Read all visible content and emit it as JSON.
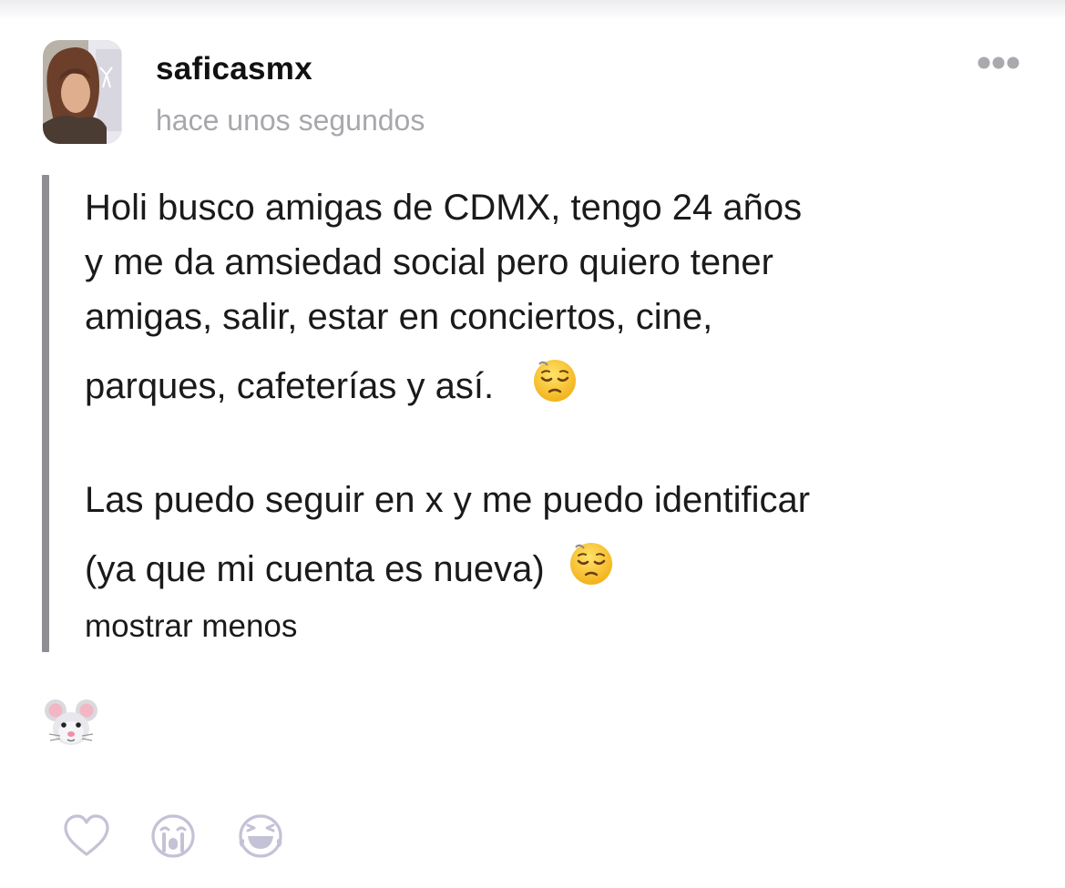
{
  "post": {
    "username": "saficasmx",
    "timestamp": "hace unos segundos",
    "more_icon": "ellipsis-icon",
    "paragraphs": [
      {
        "lines": [
          "Holi busco amigas de CDMX, tengo 24 años",
          "y me da amsiedad social pero quiero tener",
          "amigas, salir, estar en conciertos, cine,",
          "parques, cafeterías y así."
        ]
      },
      {
        "lines": [
          "Las puedo seguir en x y me puedo identificar",
          "(ya que mi cuenta es nueva)"
        ]
      }
    ],
    "inline_emoji": "pensive-face-emoji",
    "show_less_label": "mostrar menos",
    "reaction_emoji": "mouse-face-emoji"
  },
  "reactions": [
    {
      "icon": "heart-outline-icon"
    },
    {
      "icon": "crying-face-icon"
    },
    {
      "icon": "laughing-face-icon"
    }
  ],
  "colors": {
    "text": "#1a1a1a",
    "muted": "#a7a7ad",
    "quote_bar": "#8e8e93",
    "icon_stroke": "#c4c2d6"
  }
}
